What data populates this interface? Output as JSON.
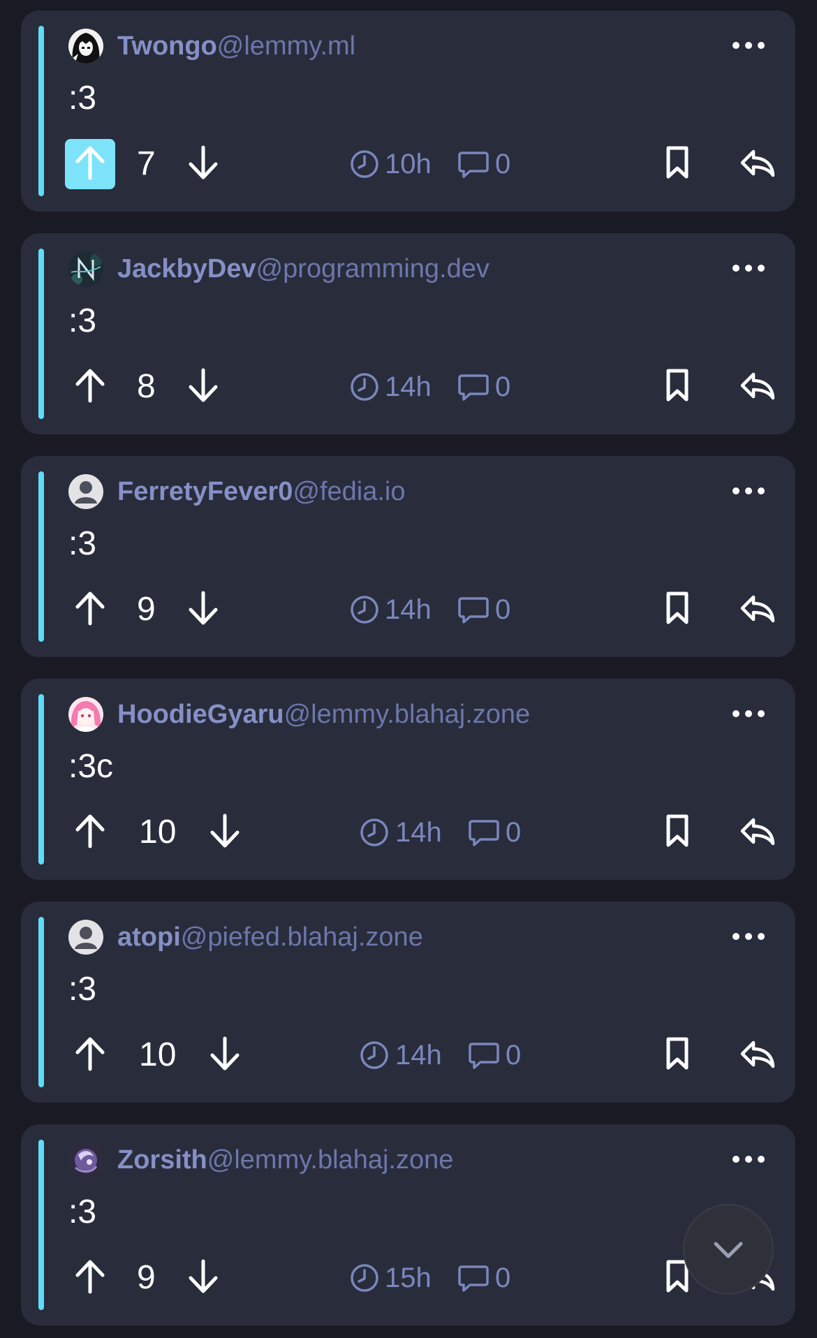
{
  "theme": {
    "accent": "#5fdcf7",
    "upvote_active_bg": "#7de3fb",
    "card_bg": "#292c3b",
    "page_bg": "#191a24",
    "author_name_color": "#8590c6",
    "instance_color": "#6c77ab",
    "meta_color": "#7b87bd"
  },
  "comments": [
    {
      "author": "Twongo",
      "instance": "@lemmy.ml",
      "avatar": "anime-character-bw",
      "body": ":3",
      "score": "7",
      "upvoted": true,
      "age": "10h",
      "replies": "0"
    },
    {
      "author": "JackbyDev",
      "instance": "@programming.dev",
      "avatar": "neon-n-logo",
      "body": ":3",
      "score": "8",
      "upvoted": false,
      "age": "14h",
      "replies": "0"
    },
    {
      "author": "FerretyFever0",
      "instance": "@fedia.io",
      "avatar": "default-user",
      "body": ":3",
      "score": "9",
      "upvoted": false,
      "age": "14h",
      "replies": "0"
    },
    {
      "author": "HoodieGyaru",
      "instance": "@lemmy.blahaj.zone",
      "avatar": "pink-hair-anime",
      "body": ":3c",
      "score": "10",
      "upvoted": false,
      "age": "14h",
      "replies": "0"
    },
    {
      "author": "atopi",
      "instance": "@piefed.blahaj.zone",
      "avatar": "default-user",
      "body": ":3",
      "score": "10",
      "upvoted": false,
      "age": "14h",
      "replies": "0"
    },
    {
      "author": "Zorsith",
      "instance": "@lemmy.blahaj.zone",
      "avatar": "purple-creature",
      "body": ":3",
      "score": "9",
      "upvoted": false,
      "age": "15h",
      "replies": "0"
    }
  ],
  "icons": {
    "more": "more-horizontal-icon",
    "upvote": "arrow-up-icon",
    "downvote": "arrow-down-icon",
    "age": "clock-icon",
    "replies": "speech-bubble-icon",
    "save": "bookmark-icon",
    "reply": "reply-arrow-icon",
    "scroll": "chevron-down-icon"
  }
}
